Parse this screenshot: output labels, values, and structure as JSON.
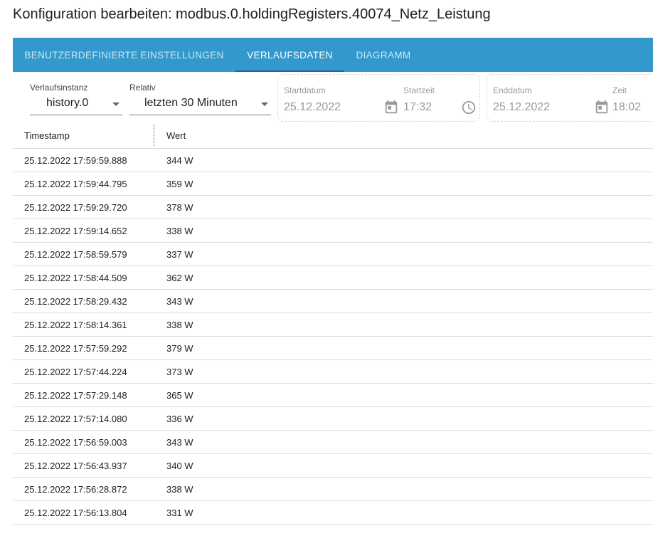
{
  "dialog": {
    "title": "Konfiguration bearbeiten: modbus.0.holdingRegisters.40074_Netz_Leistung"
  },
  "tabs": [
    {
      "label": "BENUTZERDEFINIERTE EINSTELLUNGEN",
      "active": false
    },
    {
      "label": "VERLAUFSDATEN",
      "active": true
    },
    {
      "label": "DIAGRAMM",
      "active": false
    }
  ],
  "filters": {
    "instance": {
      "label": "Verlaufsinstanz",
      "value": "history.0"
    },
    "relative": {
      "label": "Relativ",
      "value": "letzten 30 Minuten"
    },
    "start": {
      "date_label": "Startdatum",
      "date": "25.12.2022",
      "time_label": "Startzeit",
      "time": "17:32"
    },
    "end": {
      "date_label": "Enddatum",
      "date": "25.12.2022",
      "time_label": "Zeit",
      "time": "18:02"
    }
  },
  "table": {
    "columns": [
      "Timestamp",
      "Wert"
    ],
    "rows": [
      {
        "timestamp": "25.12.2022 17:59:59.888",
        "value": "344 W"
      },
      {
        "timestamp": "25.12.2022 17:59:44.795",
        "value": "359 W"
      },
      {
        "timestamp": "25.12.2022 17:59:29.720",
        "value": "378 W"
      },
      {
        "timestamp": "25.12.2022 17:59:14.652",
        "value": "338 W"
      },
      {
        "timestamp": "25.12.2022 17:58:59.579",
        "value": "337 W"
      },
      {
        "timestamp": "25.12.2022 17:58:44.509",
        "value": "362 W"
      },
      {
        "timestamp": "25.12.2022 17:58:29.432",
        "value": "343 W"
      },
      {
        "timestamp": "25.12.2022 17:58:14.361",
        "value": "338 W"
      },
      {
        "timestamp": "25.12.2022 17:57:59.292",
        "value": "379 W"
      },
      {
        "timestamp": "25.12.2022 17:57:44.224",
        "value": "373 W"
      },
      {
        "timestamp": "25.12.2022 17:57:29.148",
        "value": "365 W"
      },
      {
        "timestamp": "25.12.2022 17:57:14.080",
        "value": "336 W"
      },
      {
        "timestamp": "25.12.2022 17:56:59.003",
        "value": "343 W"
      },
      {
        "timestamp": "25.12.2022 17:56:43.937",
        "value": "340 W"
      },
      {
        "timestamp": "25.12.2022 17:56:28.872",
        "value": "338 W"
      },
      {
        "timestamp": "25.12.2022 17:56:13.804",
        "value": "331 W"
      }
    ]
  },
  "icons": {
    "calendar": "calendar-icon",
    "clock": "clock-icon",
    "dropdown": "chevron-down-icon"
  },
  "colors": {
    "tabbar": "#3399cc",
    "tab_indicator": "#2a5f8c",
    "disabled_text": "#9a9a9a"
  }
}
